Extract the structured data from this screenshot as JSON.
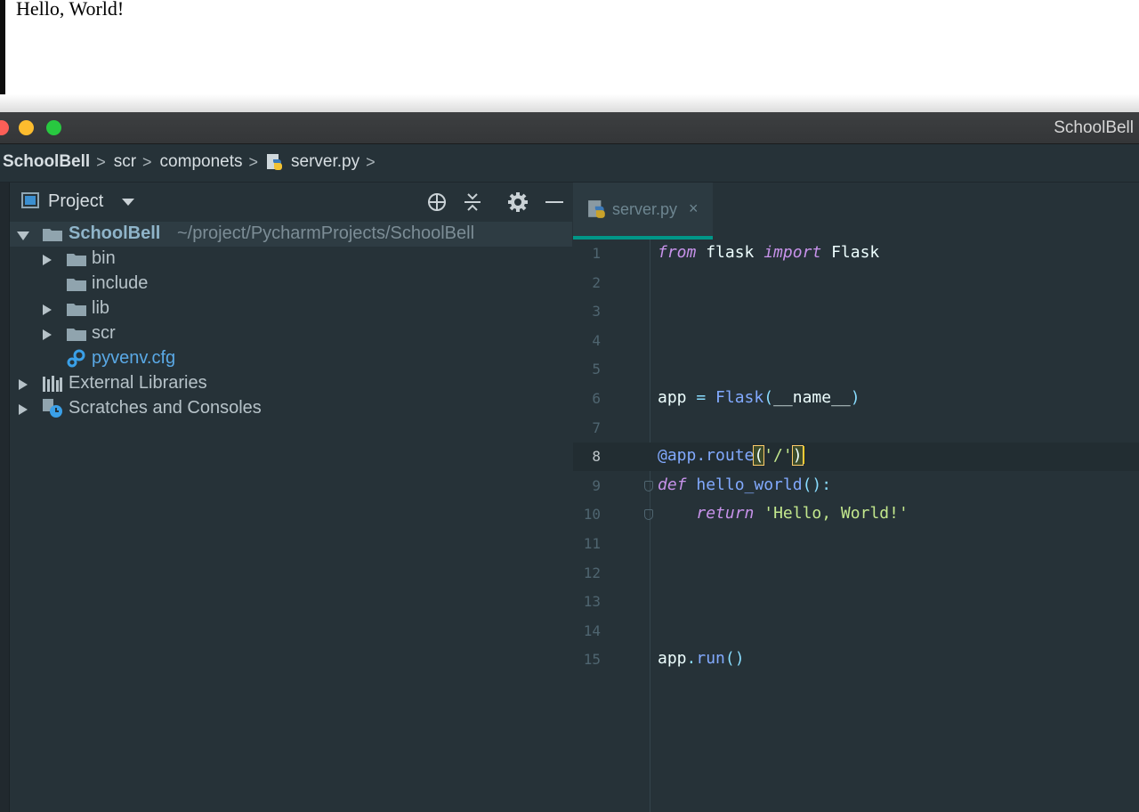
{
  "browser": {
    "content_text": "Hello, World!"
  },
  "window": {
    "title": "SchoolBell"
  },
  "breadcrumb": [
    {
      "label": "SchoolBell"
    },
    {
      "label": "scr"
    },
    {
      "label": "componets"
    },
    {
      "label": "server.py",
      "icon": "python-file-icon"
    }
  ],
  "project_panel": {
    "title": "Project",
    "toolbar_icons": [
      "locate-icon",
      "collapse-all-icon",
      "gear-icon",
      "minimize-icon"
    ],
    "tree": [
      {
        "label": "SchoolBell",
        "path": "~/project/PycharmProjects/SchoolBell",
        "expanded": true,
        "selected": true
      },
      {
        "label": "bin",
        "type": "folder"
      },
      {
        "label": "include",
        "type": "folder"
      },
      {
        "label": "lib",
        "type": "folder"
      },
      {
        "label": "scr",
        "type": "folder"
      },
      {
        "label": "pyvenv.cfg",
        "type": "config-file"
      },
      {
        "label": "External Libraries",
        "type": "libraries"
      },
      {
        "label": "Scratches and Consoles",
        "type": "scratches"
      }
    ]
  },
  "editor": {
    "tabs": [
      {
        "label": "server.py",
        "close": "×",
        "active": true
      }
    ],
    "current_line": 8,
    "lines": [
      {
        "n": "1",
        "tokens": [
          [
            "kw",
            "from"
          ],
          [
            "plain",
            " flask "
          ],
          [
            "kw",
            "import"
          ],
          [
            "plain",
            " Flask"
          ]
        ]
      },
      {
        "n": "2",
        "tokens": []
      },
      {
        "n": "3",
        "tokens": []
      },
      {
        "n": "4",
        "tokens": []
      },
      {
        "n": "5",
        "tokens": []
      },
      {
        "n": "6",
        "tokens": [
          [
            "plain",
            "app "
          ],
          [
            "op",
            "="
          ],
          [
            "plain",
            " "
          ],
          [
            "fn",
            "Flask"
          ],
          [
            "op",
            "("
          ],
          [
            "plain",
            "__name__"
          ],
          [
            "op",
            ")"
          ]
        ]
      },
      {
        "n": "7",
        "tokens": []
      },
      {
        "n": "8",
        "tokens": [
          [
            "fn",
            "@app.route"
          ],
          [
            "br",
            "("
          ],
          [
            "str",
            "'/'"
          ],
          [
            "br",
            ")"
          ]
        ]
      },
      {
        "n": "9",
        "tokens": [
          [
            "kw",
            "def"
          ],
          [
            "plain",
            " "
          ],
          [
            "fn",
            "hello_world"
          ],
          [
            "op",
            "():"
          ]
        ]
      },
      {
        "n": "10",
        "tokens": [
          [
            "plain",
            "    "
          ],
          [
            "kw",
            "return"
          ],
          [
            "plain",
            " "
          ],
          [
            "str",
            "'Hello, World!'"
          ]
        ]
      },
      {
        "n": "11",
        "tokens": []
      },
      {
        "n": "12",
        "tokens": []
      },
      {
        "n": "13",
        "tokens": []
      },
      {
        "n": "14",
        "tokens": []
      },
      {
        "n": "15",
        "tokens": [
          [
            "plain",
            "app"
          ],
          [
            "op",
            "."
          ],
          [
            "fn",
            "run"
          ],
          [
            "op",
            "()"
          ]
        ]
      }
    ]
  }
}
